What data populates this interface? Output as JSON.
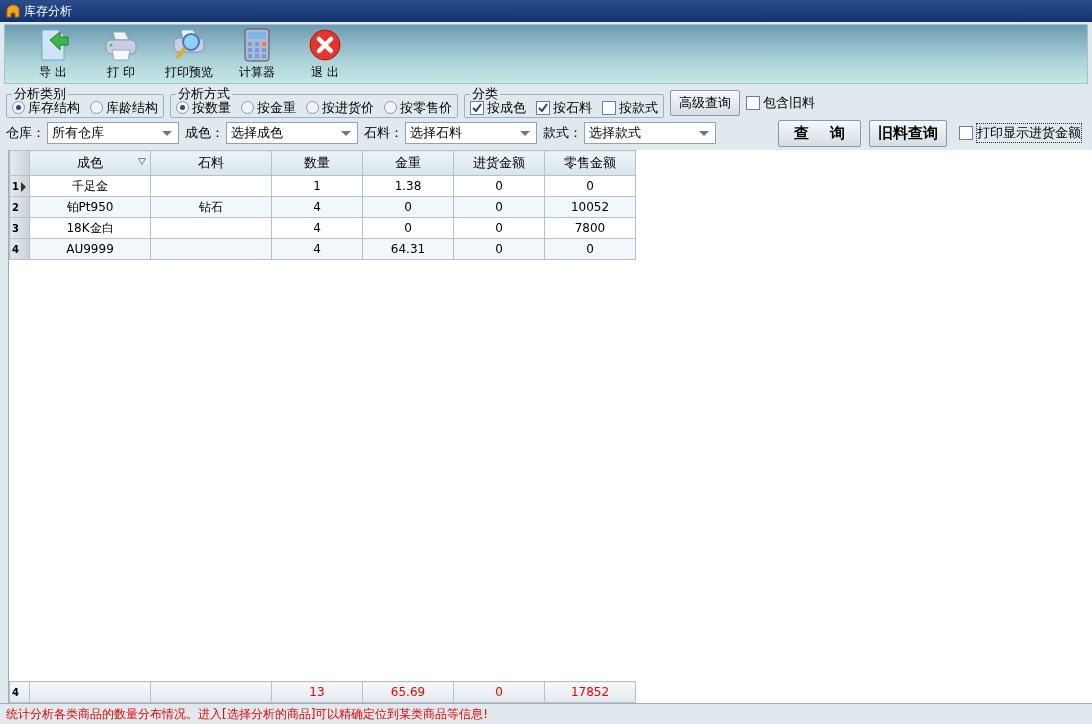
{
  "window": {
    "title": "库存分析"
  },
  "toolbar": [
    {
      "label": "导 出",
      "kind": "export"
    },
    {
      "label": "打 印",
      "kind": "print"
    },
    {
      "label": "打印预览",
      "kind": "preview"
    },
    {
      "label": "计算器",
      "kind": "calculator"
    },
    {
      "label": "退 出",
      "kind": "exit"
    }
  ],
  "analysis_type": {
    "legend": "分析类别",
    "options": [
      {
        "label": "库存结构",
        "selected": true
      },
      {
        "label": "库龄结构",
        "selected": false
      }
    ]
  },
  "analysis_method": {
    "legend": "分析方式",
    "options": [
      {
        "label": "按数量",
        "selected": true
      },
      {
        "label": "按金重",
        "selected": false
      },
      {
        "label": "按进货价",
        "selected": false
      },
      {
        "label": "按零售价",
        "selected": false
      }
    ]
  },
  "category": {
    "legend": "分类",
    "options": [
      {
        "label": "按成色",
        "checked": true
      },
      {
        "label": "按石料",
        "checked": true
      },
      {
        "label": "按款式",
        "checked": false
      }
    ]
  },
  "advanced_button": "高级查询",
  "include_old": {
    "label": "包含旧料",
    "checked": false
  },
  "filters": [
    {
      "label": "仓库：",
      "value": "所有仓库"
    },
    {
      "label": "成色：",
      "value": "选择成色"
    },
    {
      "label": "石料：",
      "value": "选择石料"
    },
    {
      "label": "款式：",
      "value": "选择款式"
    }
  ],
  "query_button": "查    询",
  "old_query_button": "旧料查询",
  "print_purchase": {
    "label": "打印显示进货金额",
    "checked": false
  },
  "table": {
    "columns": [
      {
        "label": "成色",
        "filter": true
      },
      {
        "label": "石料",
        "filter": false
      },
      {
        "label": "数量",
        "filter": false
      },
      {
        "label": "金重",
        "filter": false
      },
      {
        "label": "进货金额",
        "filter": false
      },
      {
        "label": "零售金额",
        "filter": false
      }
    ],
    "rows": [
      {
        "header": "1",
        "current": true,
        "cells": [
          "千足金",
          null,
          "1",
          "1.38",
          "0",
          "0"
        ]
      },
      {
        "header": "2",
        "current": false,
        "cells": [
          "铂Pt950",
          "钻石",
          "4",
          "0",
          "0",
          "10052"
        ]
      },
      {
        "header": "3",
        "current": false,
        "cells": [
          "18K金白",
          null,
          "4",
          "0",
          "0",
          "7800"
        ]
      },
      {
        "header": "4",
        "current": false,
        "cells": [
          "AU9999",
          null,
          "4",
          "64.31",
          "0",
          "0"
        ]
      }
    ],
    "footer": {
      "header": "4",
      "cells": [
        null,
        null,
        "13",
        "65.69",
        "0",
        "17852"
      ]
    }
  },
  "status_bar": "统计分析各类商品的数量分布情况。进入[选择分析的商品]可以精确定位到某类商品等信息!"
}
